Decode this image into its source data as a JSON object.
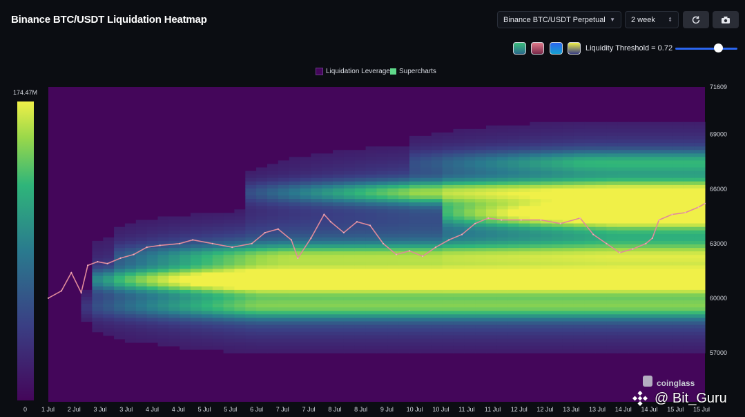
{
  "header": {
    "title": "Binance BTC/USDT Liquidation Heatmap",
    "market_select": "Binance BTC/USDT Perpetual",
    "period_select": "2 week",
    "refresh_icon": "refresh-icon",
    "camera_icon": "camera-icon"
  },
  "controls": {
    "palettes": [
      {
        "name": "palette-green",
        "colors": [
          "#3bbd7a",
          "#2a6a8a"
        ]
      },
      {
        "name": "palette-red",
        "colors": [
          "#e07a8a",
          "#7a2a4a"
        ]
      },
      {
        "name": "palette-blue",
        "colors": [
          "#2b66f0",
          "#16a0d0"
        ]
      },
      {
        "name": "palette-viridis",
        "colors": [
          "#f0f048",
          "#3a3f84"
        ]
      }
    ],
    "threshold_label": "Liquidity Threshold = 0.72",
    "threshold_value": 0.72
  },
  "legend": {
    "items": [
      {
        "label": "Liquidation Leverage",
        "color": "#44065a"
      },
      {
        "label": "Supercharts",
        "color": "#5fd88a"
      }
    ]
  },
  "colorbar": {
    "max_label": "174.47M",
    "min_label": "0",
    "colors": [
      "#44065a",
      "#3a3f84",
      "#2a7a8e",
      "#2fb57a",
      "#9ad84a",
      "#f0f048"
    ]
  },
  "watermark": {
    "brand": "coinglass",
    "author": "@ Bit_Guru"
  },
  "chart_data": {
    "type": "heatmap",
    "title": "Binance BTC/USDT Liquidation Heatmap",
    "x_tick_labels": [
      "1 Jul",
      "2 Jul",
      "3 Jul",
      "3 Jul",
      "4 Jul",
      "4 Jul",
      "5 Jul",
      "5 Jul",
      "6 Jul",
      "7 Jul",
      "7 Jul",
      "8 Jul",
      "8 Jul",
      "9 Jul",
      "10 Jul",
      "10 Jul",
      "11 Jul",
      "11 Jul",
      "12 Jul",
      "12 Jul",
      "13 Jul",
      "13 Jul",
      "14 Jul",
      "14 Jul",
      "15 Jul",
      "15 Jul"
    ],
    "y_tick_labels": [
      "71609",
      "69000",
      "66000",
      "63000",
      "60000",
      "57000"
    ],
    "y_ticks": [
      71609,
      69000,
      66000,
      63000,
      60000,
      57000
    ],
    "ylim": [
      54300,
      71609
    ],
    "xlim": [
      0,
      1
    ],
    "price_series": {
      "name": "BTC/USDT",
      "x": [
        0.0,
        0.02,
        0.035,
        0.05,
        0.06,
        0.075,
        0.09,
        0.11,
        0.13,
        0.15,
        0.17,
        0.2,
        0.22,
        0.25,
        0.28,
        0.31,
        0.33,
        0.35,
        0.37,
        0.38,
        0.4,
        0.42,
        0.43,
        0.45,
        0.47,
        0.49,
        0.51,
        0.53,
        0.55,
        0.57,
        0.59,
        0.61,
        0.63,
        0.65,
        0.67,
        0.69,
        0.72,
        0.75,
        0.78,
        0.81,
        0.83,
        0.85,
        0.87,
        0.89,
        0.91,
        0.92,
        0.93,
        0.95,
        0.97,
        0.99,
        1.0
      ],
      "y": [
        60000,
        60400,
        61400,
        60300,
        61800,
        62000,
        61900,
        62200,
        62400,
        62800,
        62900,
        63000,
        63200,
        63000,
        62800,
        63000,
        63600,
        63800,
        63200,
        62200,
        63300,
        64600,
        64200,
        63600,
        64200,
        64000,
        63000,
        62400,
        62600,
        62300,
        62800,
        63200,
        63500,
        64100,
        64400,
        64300,
        64300,
        64300,
        64100,
        64400,
        63500,
        63000,
        62500,
        62700,
        63000,
        63300,
        64300,
        64600,
        64700,
        65000,
        65200
      ]
    },
    "liquidation_bands": [
      {
        "price": 61000,
        "intensity": 1.0,
        "x_start": 0.06
      },
      {
        "price": 64650,
        "intensity": 1.0,
        "x_start": 0.6
      },
      {
        "price": 65800,
        "intensity": 0.55,
        "x_start": 0.3
      },
      {
        "price": 62300,
        "intensity": 0.4,
        "x_start": 0.1
      },
      {
        "price": 59500,
        "intensity": 0.35,
        "x_start": 0.05
      },
      {
        "price": 67500,
        "intensity": 0.3,
        "x_start": 0.55
      }
    ],
    "grid": false,
    "legend_position": "top-center"
  }
}
